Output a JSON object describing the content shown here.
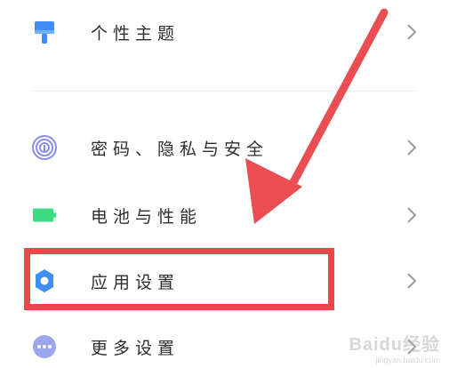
{
  "settings": {
    "items": [
      {
        "label": "个性主题",
        "icon": "theme-brush-icon"
      },
      {
        "label": "密码、隐私与安全",
        "icon": "fingerprint-icon"
      },
      {
        "label": "电池与性能",
        "icon": "battery-icon"
      },
      {
        "label": "应用设置",
        "icon": "gear-icon"
      },
      {
        "label": "更多设置",
        "icon": "more-dots-icon"
      }
    ]
  },
  "watermark": {
    "logo": "Baidu经验",
    "url": "jingyan.baidu.com"
  },
  "colors": {
    "highlight": "#e9474c",
    "arrow": "#ea4d52",
    "icon_blue": "#3f8ef5",
    "icon_green": "#3ddc84",
    "icon_purple": "#8a8ef0",
    "icon_lavender": "#9aa6ee",
    "chevron": "#9a9a9a"
  }
}
